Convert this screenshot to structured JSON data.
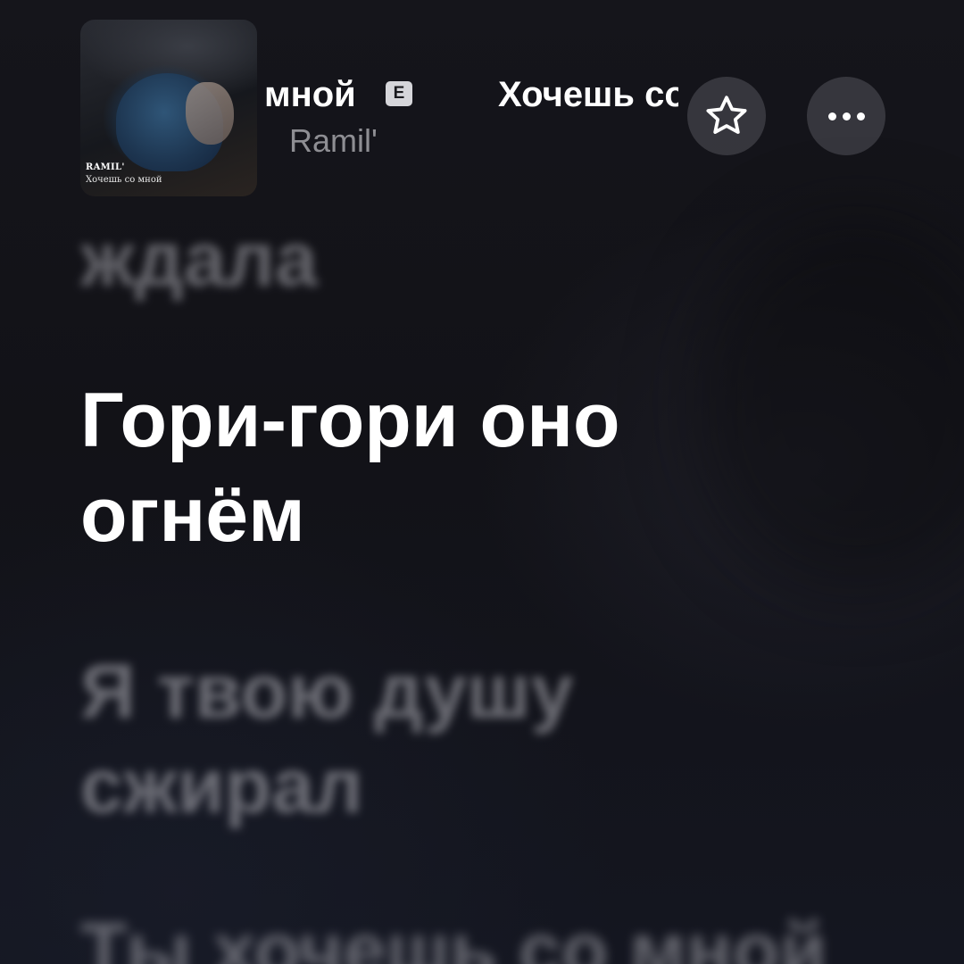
{
  "header": {
    "cover_artist": "RAMIL'",
    "cover_title": "Хочешь со мной",
    "title_tail": "мной",
    "explicit_badge": "E",
    "title_marquee": "Хочешь со мной",
    "artist": "Ramil'"
  },
  "actions": {
    "favorite_icon": "star-outline-icon",
    "more_icon": "ellipsis-icon"
  },
  "lyrics": {
    "previous": "ждала",
    "current": "Гори-гори оно\nогнём",
    "next": "Я твою душу\nсжирал",
    "next2": "Ты хочешь со мной"
  },
  "colors": {
    "background": "#121217",
    "active_lyric": "#ffffff",
    "inactive_lyric": "#a5a5ac",
    "secondary_text": "#8e8e93"
  }
}
